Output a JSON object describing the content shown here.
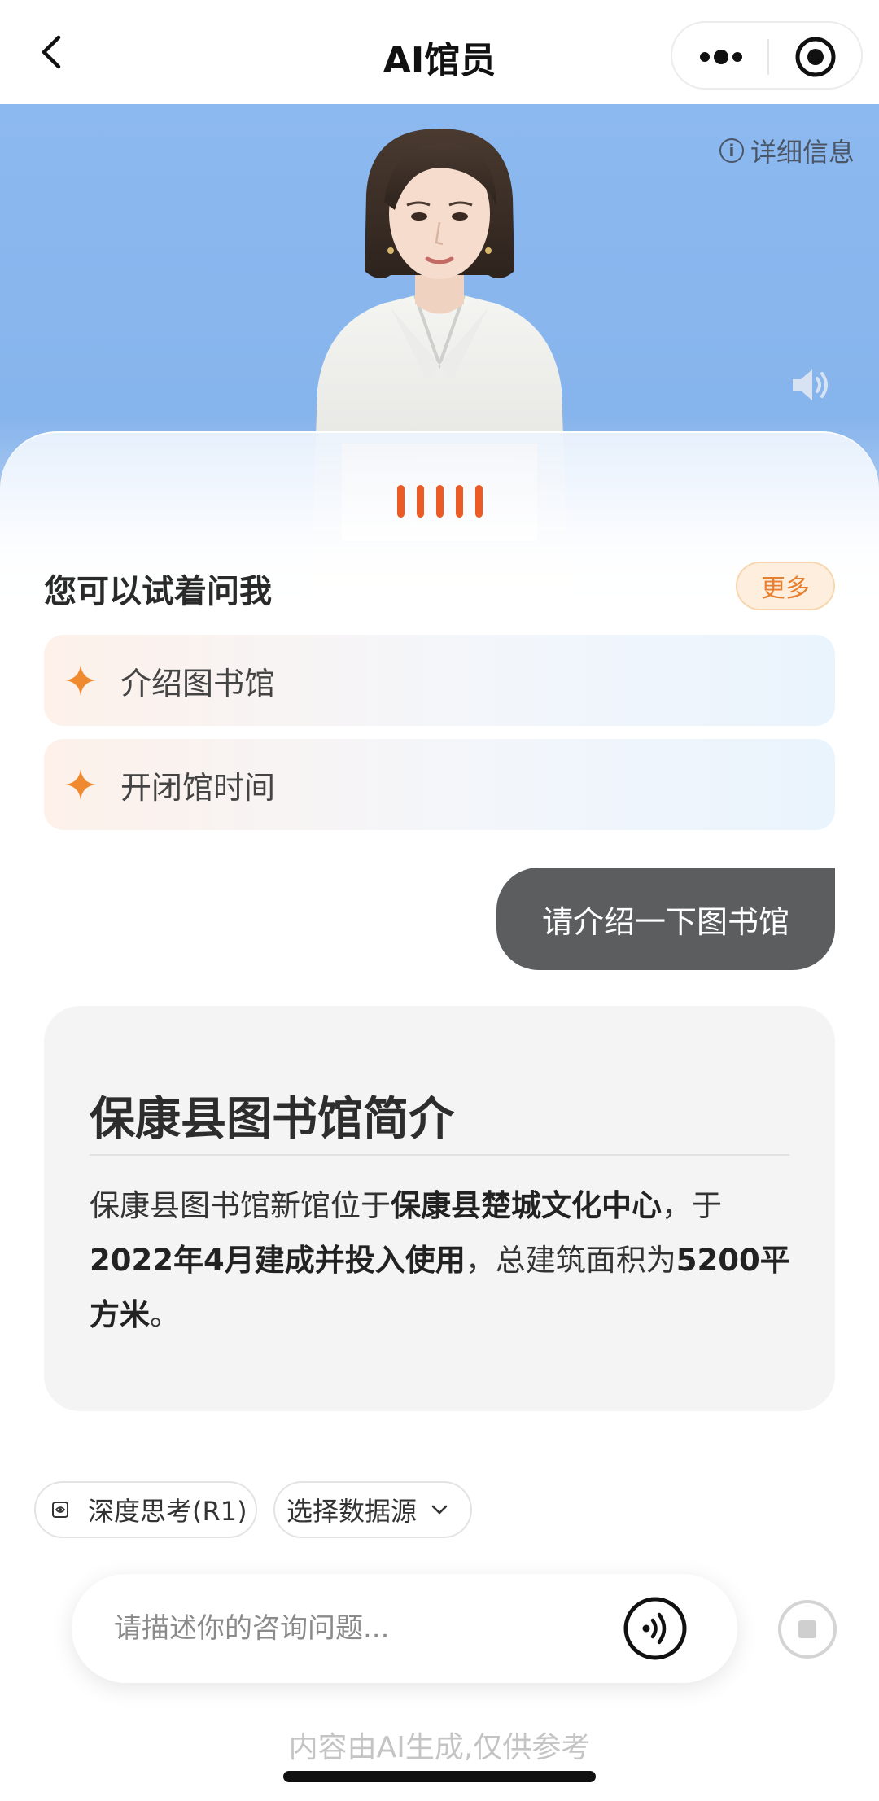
{
  "navbar": {
    "title": "AI馆员",
    "back_icon": "chevron-left-icon",
    "more_icon": "more-dots-icon",
    "target_icon": "record-target-icon"
  },
  "avatar": {
    "detail_label": "详细信息",
    "info_icon_glyph": "i",
    "speaker_icon": "speaker-icon",
    "background_color": "#8cb9ef"
  },
  "voice_indicator": {
    "color": "#ec5a26"
  },
  "suggestions": {
    "title": "您可以试着问我",
    "more_label": "更多",
    "items": [
      {
        "label": "介绍图书馆"
      },
      {
        "label": "开闭馆时间"
      }
    ],
    "accent_color": "#f08a30"
  },
  "conversation": {
    "user_message": "请介绍一下图书馆",
    "answer": {
      "title": "保康县图书馆简介",
      "body_parts": [
        "保康县图书馆新馆位于",
        "保康县楚城文化中心",
        "，于",
        "2022年4月建成并投入使用",
        "，总建筑面积为",
        "5200平方米",
        "。"
      ]
    }
  },
  "toolbar": {
    "deep_think_label": "深度思考(R1)",
    "data_source_label": "选择数据源"
  },
  "input": {
    "placeholder": "请描述你的咨询问题...",
    "value": ""
  },
  "footer": {
    "disclaimer": "内容由AI生成,仅供参考"
  }
}
